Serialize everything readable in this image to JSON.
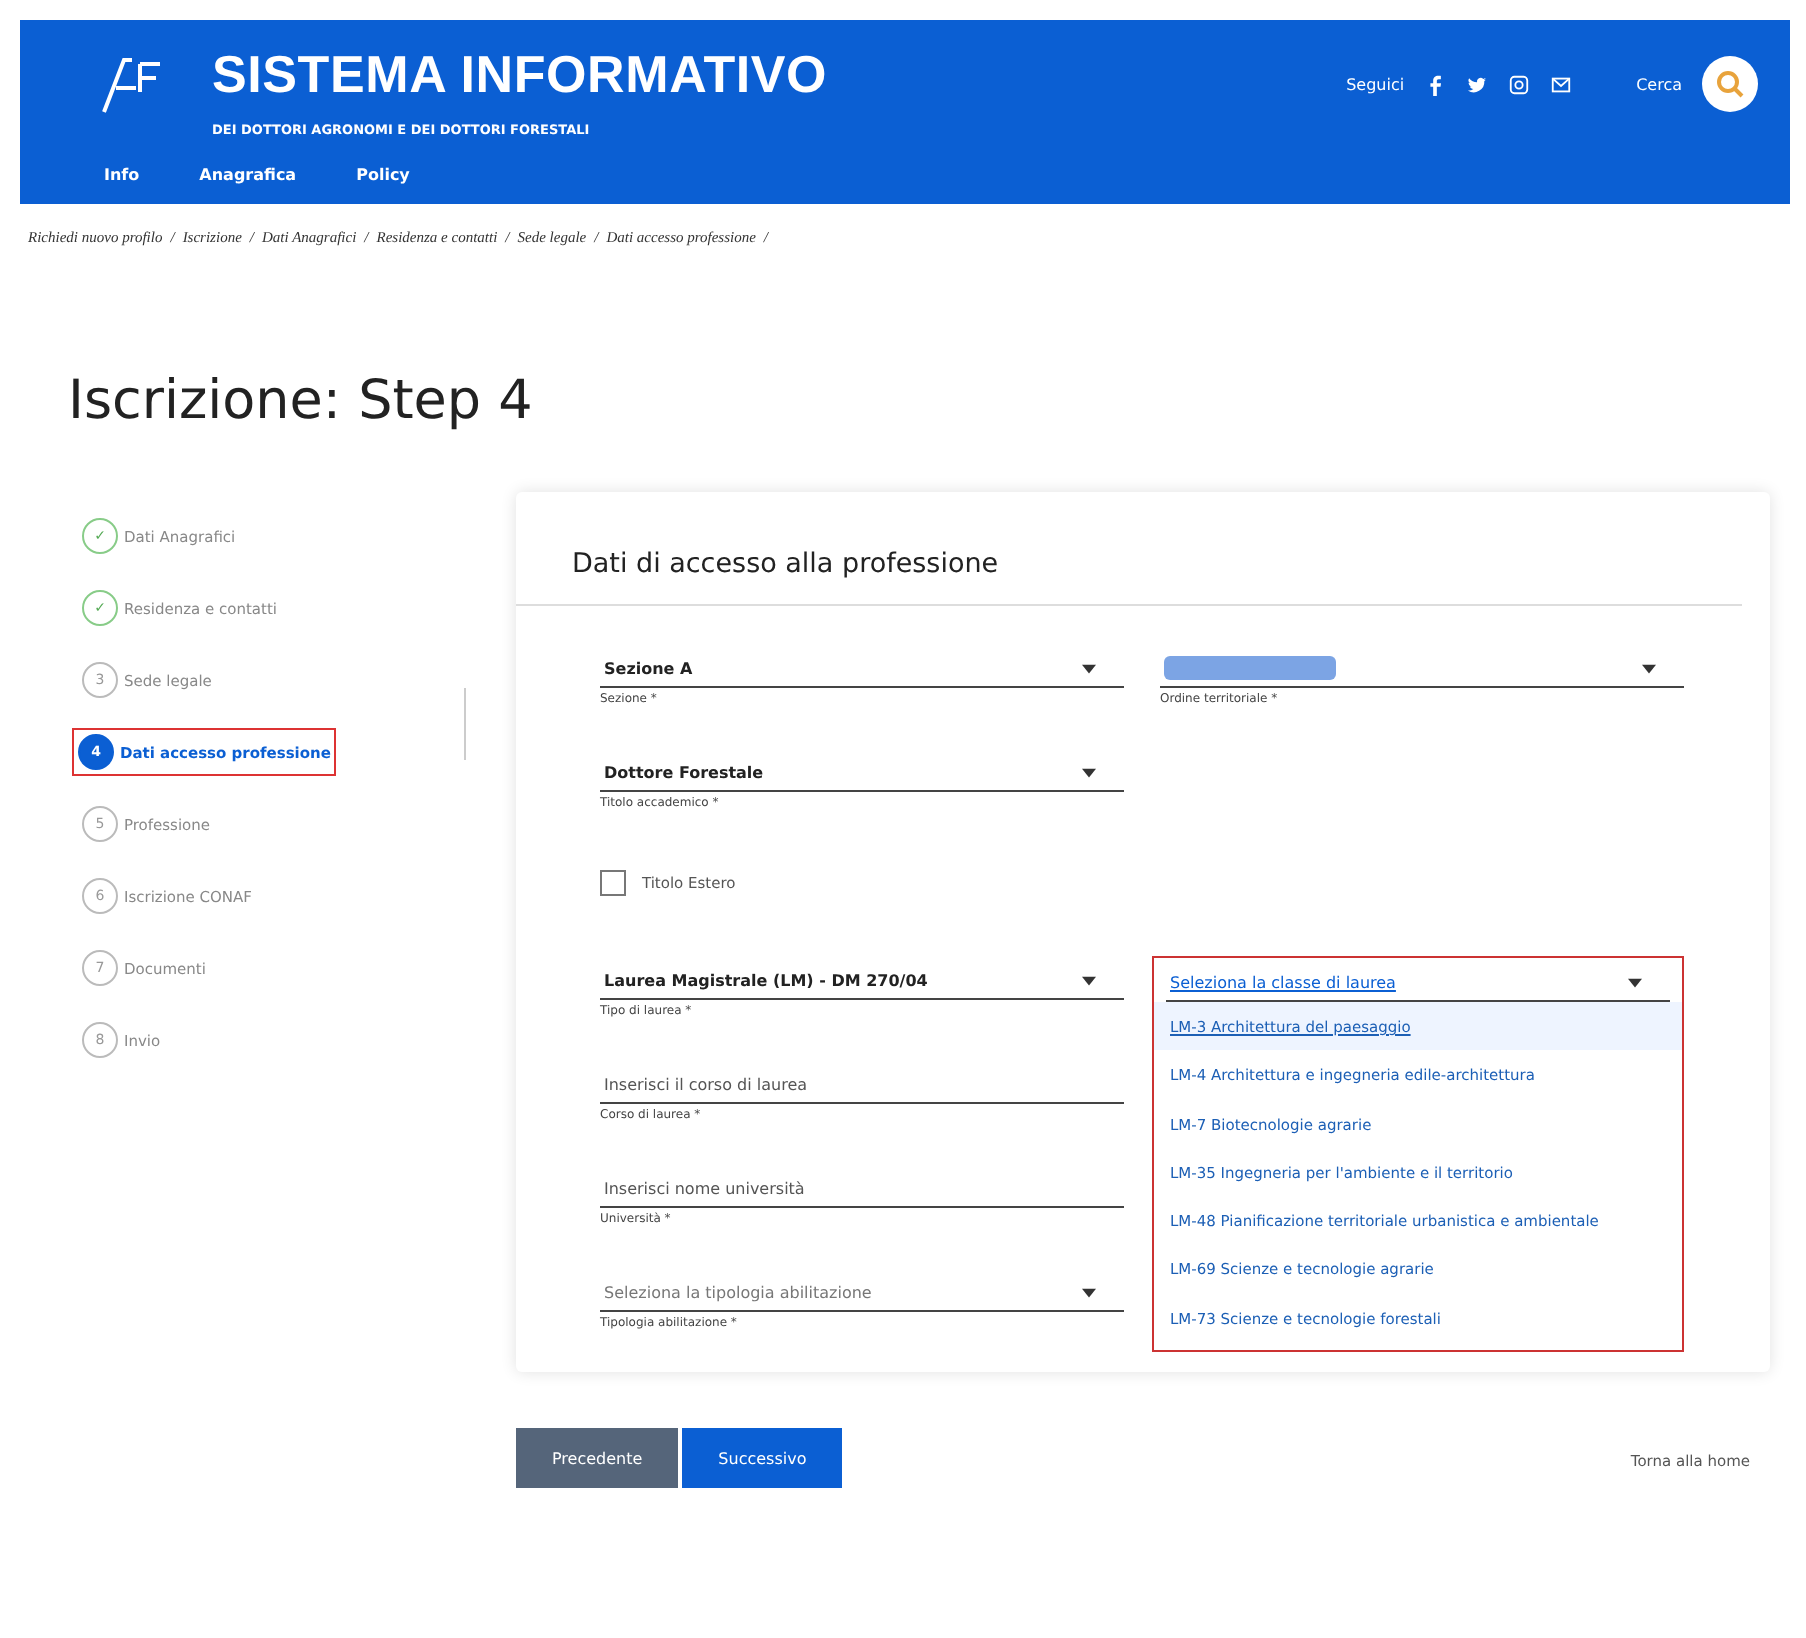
{
  "header": {
    "title": "SISTEMA INFORMATIVO",
    "subtitle": "DEI DOTTORI AGRONOMI E DEI DOTTORI FORESTALI",
    "nav": [
      "Info",
      "Anagrafica",
      "Policy"
    ],
    "follow_label": "Seguici",
    "search_label": "Cerca"
  },
  "breadcrumb_separator": "/",
  "breadcrumb": [
    "Richiedi nuovo profilo",
    "Iscrizione",
    "Dati Anagrafici",
    "Residenza e contatti",
    "Sede legale",
    "Dati accesso professione"
  ],
  "page_title": "Iscrizione: Step 4",
  "steps": [
    {
      "marker": "✓",
      "label": "Dati Anagrafici",
      "done": true,
      "selected": false
    },
    {
      "marker": "✓",
      "label": "Residenza e contatti",
      "done": true,
      "selected": false
    },
    {
      "marker": "3",
      "label": "Sede legale",
      "done": false,
      "selected": false
    },
    {
      "marker": "4",
      "label": "Dati accesso professione",
      "done": false,
      "selected": true
    },
    {
      "marker": "5",
      "label": "Professione",
      "done": false,
      "selected": false
    },
    {
      "marker": "6",
      "label": "Iscrizione CONAF",
      "done": false,
      "selected": false
    },
    {
      "marker": "7",
      "label": "Documenti",
      "done": false,
      "selected": false
    },
    {
      "marker": "8",
      "label": "Invio",
      "done": false,
      "selected": false
    }
  ],
  "form": {
    "heading": "Dati di accesso alla professione",
    "fields": [
      {
        "kind": "select",
        "value": "Sezione A",
        "label": "Sezione *"
      },
      {
        "kind": "redacted",
        "label": "Ordine territoriale *"
      },
      {
        "kind": "select",
        "value": "Dottore Forestale",
        "label": "Titolo accademico *"
      },
      {
        "kind": "blank"
      },
      {
        "kind": "checkbox",
        "text": "Titolo Estero",
        "checked": false
      },
      {
        "kind": "blank"
      },
      {
        "kind": "select",
        "value": "Laurea Magistrale (LM) - DM 270/04",
        "label": "Tipo di laurea *"
      },
      {
        "kind": "dropdown",
        "placeholder": "Seleziona la classe di laurea",
        "options": [
          {
            "text": "LM-3 Architettura del paesaggio",
            "selected": true
          },
          {
            "text": "LM-4 Architettura e ingegneria edile-architettura",
            "selected": false
          },
          {
            "text": "LM-7 Biotecnologie agrarie",
            "selected": false
          },
          {
            "text": "LM-35 Ingegneria per l'ambiente e il territorio",
            "selected": false
          },
          {
            "text": "LM-48 Pianificazione territoriale urbanistica e ambientale",
            "selected": false
          },
          {
            "text": "LM-69 Scienze e tecnologie agrarie",
            "selected": false
          },
          {
            "text": "LM-73 Scienze e tecnologie forestali",
            "selected": false
          }
        ]
      },
      {
        "kind": "input",
        "placeholder": "Inserisci il corso di laurea",
        "label": "Corso di laurea *"
      },
      {
        "kind": "blank"
      },
      {
        "kind": "input",
        "placeholder": "Inserisci nome università",
        "label": "Università *"
      },
      {
        "kind": "blank"
      },
      {
        "kind": "select",
        "placeholder": "Seleziona la tipologia abilitazione",
        "label": "Tipologia abilitazione *"
      },
      {
        "kind": "blank"
      }
    ]
  },
  "buttons": [
    {
      "text": "Precedente",
      "kind": "secondary"
    },
    {
      "text": "Successivo",
      "kind": "primary"
    }
  ],
  "home_link": "Torna alla home"
}
